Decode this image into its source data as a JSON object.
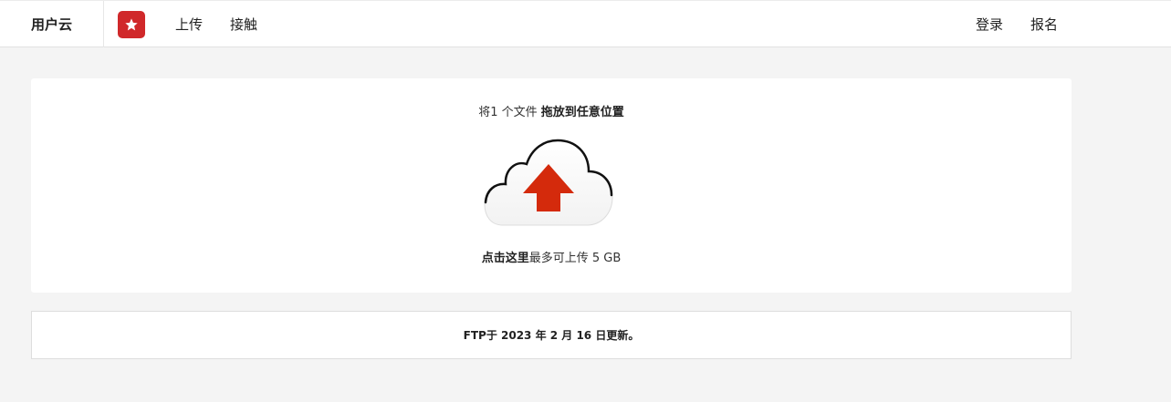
{
  "nav": {
    "brand": "用户云",
    "upload": "上传",
    "contact": "接触",
    "login": "登录",
    "signup": "报名"
  },
  "icons": {
    "logo": "star-icon",
    "upload": "cloud-upload-icon"
  },
  "colors": {
    "logo_bg": "#d0282a",
    "upload_arrow": "#d42a0c"
  },
  "upload": {
    "drop_prefix": "将1 个文件",
    "drop_bold": "拖放到任意位置",
    "click_bold": "点击这里",
    "click_suffix": "最多可上传 5 GB"
  },
  "info": {
    "text": "FTP于 2023 年 2 月 16 日更新。"
  }
}
